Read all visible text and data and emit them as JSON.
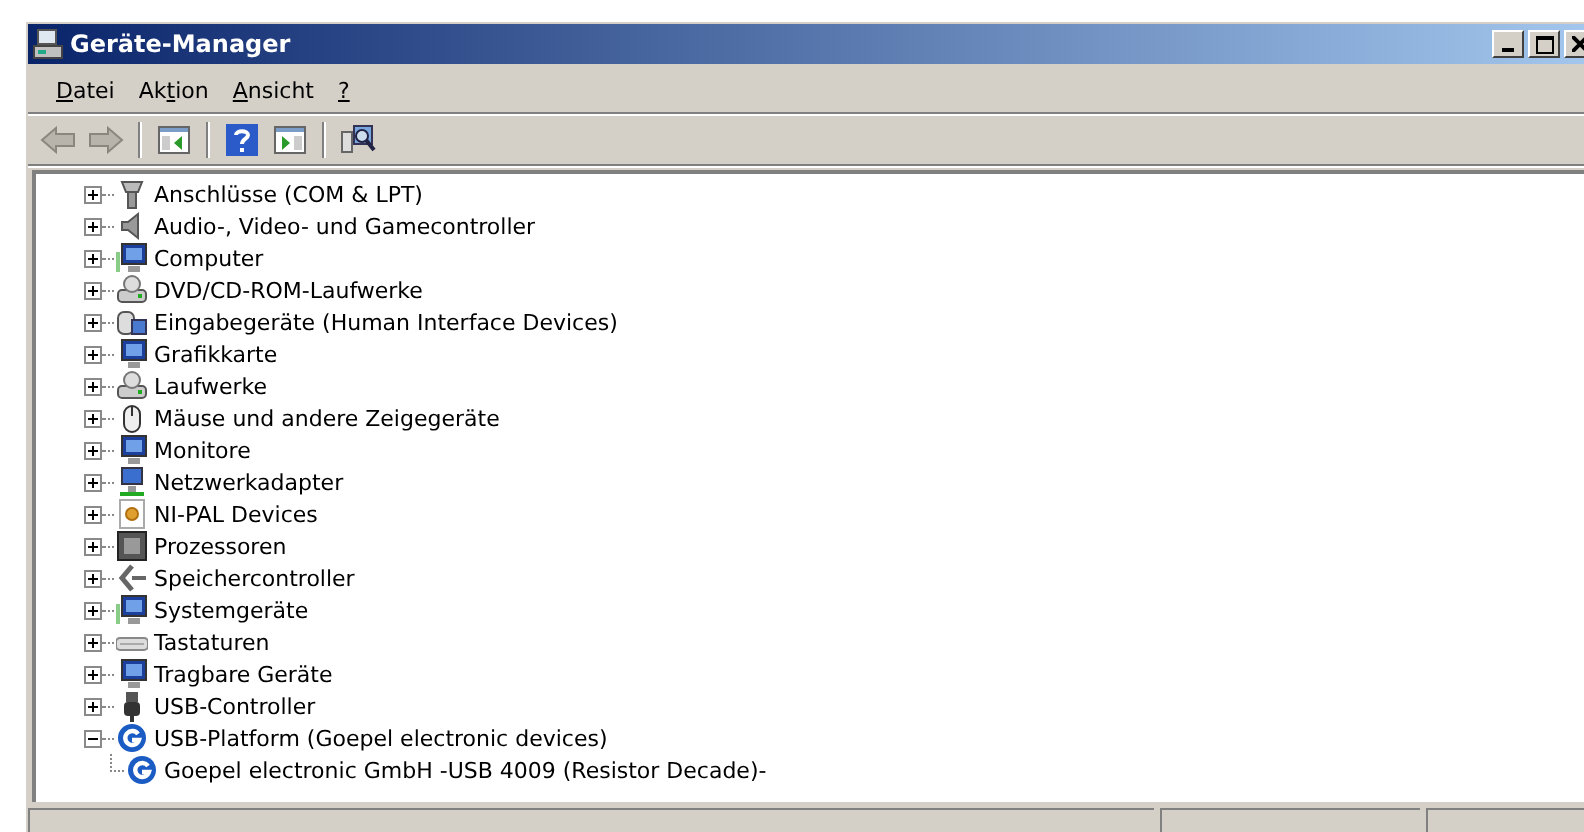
{
  "window": {
    "title": "Geräte-Manager"
  },
  "menu": [
    {
      "access_key": "D",
      "rest": "atei"
    },
    {
      "lead": "Ak",
      "access_key": "t",
      "rest": "ion"
    },
    {
      "access_key": "A",
      "rest": "nsicht"
    },
    {
      "access_key": "?"
    }
  ],
  "toolbar": [
    {
      "kind": "back",
      "disabled": true
    },
    {
      "kind": "forward",
      "disabled": true
    },
    {
      "kind": "separator"
    },
    {
      "kind": "tree",
      "disabled": false
    },
    {
      "kind": "separator"
    },
    {
      "kind": "help",
      "disabled": false
    },
    {
      "kind": "properties",
      "disabled": false
    },
    {
      "kind": "separator"
    },
    {
      "kind": "scan",
      "disabled": false
    }
  ],
  "tree": [
    {
      "label": "Anschlüsse (COM & LPT)",
      "expanded": false
    },
    {
      "label": "Audio-, Video- und Gamecontroller",
      "expanded": false
    },
    {
      "label": "Computer",
      "expanded": false
    },
    {
      "label": "DVD/CD-ROM-Laufwerke",
      "expanded": false
    },
    {
      "label": "Eingabegeräte (Human Interface Devices)",
      "expanded": false
    },
    {
      "label": "Grafikkarte",
      "expanded": false
    },
    {
      "label": "Laufwerke",
      "expanded": false
    },
    {
      "label": "Mäuse und andere Zeigegeräte",
      "expanded": false
    },
    {
      "label": "Monitore",
      "expanded": false
    },
    {
      "label": "Netzwerkadapter",
      "expanded": false
    },
    {
      "label": "NI-PAL Devices",
      "expanded": false
    },
    {
      "label": "Prozessoren",
      "expanded": false
    },
    {
      "label": "Speichercontroller",
      "expanded": false
    },
    {
      "label": "Systemgeräte",
      "expanded": false
    },
    {
      "label": "Tastaturen",
      "expanded": false
    },
    {
      "label": "Tragbare Geräte",
      "expanded": false
    },
    {
      "label": "USB-Controller",
      "expanded": false
    },
    {
      "label": "USB-Platform (Goepel electronic devices)",
      "expanded": true,
      "children": [
        {
          "label": "Goepel electronic GmbH -USB 4009 (Resistor Decade)-"
        }
      ]
    }
  ]
}
